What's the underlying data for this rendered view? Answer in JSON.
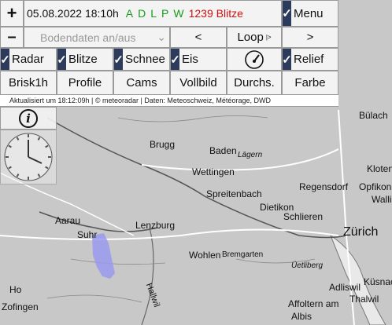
{
  "header": {
    "zoom_in": "+",
    "zoom_out": "–",
    "datetime": "05.08.2022 18:10h",
    "layers_letters": [
      "A",
      "D",
      "L",
      "P",
      "W"
    ],
    "blitz_count": "1239 Blitze",
    "menu_label": "Menu",
    "bodendaten_label": "Bodendaten an/aus",
    "prev_label": "<",
    "loop_label": "Loop",
    "loop_sup": "|>",
    "next_label": ">"
  },
  "toggles": [
    {
      "label": "Radar",
      "checked": true
    },
    {
      "label": "Blitze",
      "checked": true
    },
    {
      "label": "Schnee",
      "checked": true
    },
    {
      "label": "Eis",
      "checked": true
    },
    {
      "label": "Relief",
      "checked": true
    }
  ],
  "buttons": [
    "Brisk1h",
    "Profile",
    "Cams",
    "Vollbild",
    "Durchs.",
    "Farbe"
  ],
  "status_line": "Aktualisiert um 18:12:09h | © meteoradar | Daten: Meteoschweiz, Météorage, DWD",
  "info_symbol": "i",
  "check_symbol": "✓",
  "map": {
    "places": [
      "Brugg",
      "Baden",
      "Lägern",
      "Wettingen",
      "Spreitenbach",
      "Regensdorf",
      "Opfikon",
      "Kloten",
      "Bülach",
      "Wallis",
      "Dietikon",
      "Schlieren",
      "Zürich",
      "Aarau",
      "Suhr",
      "Lenzburg",
      "Wohlen",
      "Bremgarten",
      "Üetliberg",
      "Küsnacht",
      "Adliswil",
      "Affoltern am",
      "Albis",
      "Thalwil",
      "Zofingen",
      "Ho",
      "Hallwil"
    ]
  },
  "colors": {
    "checkbox_bg": "#2c3a5c",
    "blitz_count": "#d01010",
    "layer_letters": "#1a9a1a",
    "radar_blob": "#9a9af0"
  }
}
